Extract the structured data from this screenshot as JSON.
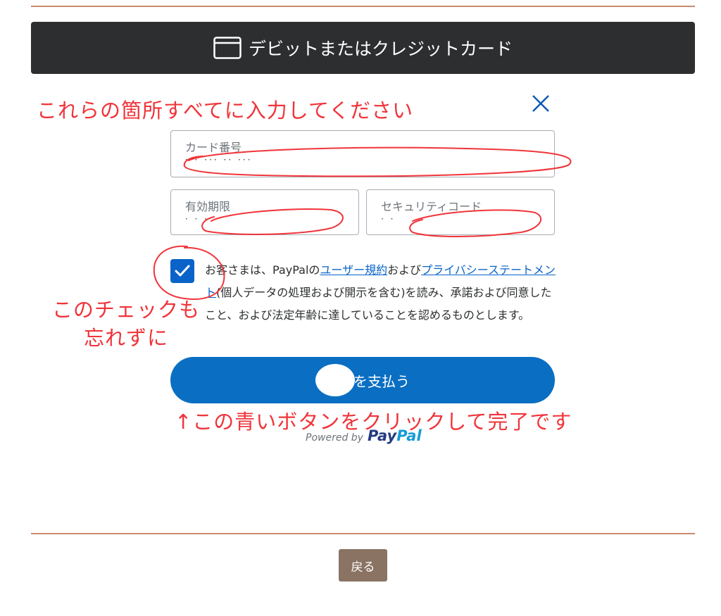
{
  "header": {
    "title": "デビットまたはクレジットカード",
    "icon": "credit-card-icon"
  },
  "annotations": {
    "top": "これらの箇所すべてに入力してください",
    "check_line1": "このチェックも",
    "check_line2": "忘れずに",
    "bottom": "↑この青いボタンをクリックして完了です",
    "color": "#f0343a"
  },
  "form": {
    "card_number_label": "カード番号",
    "card_number_value": "··· ··· ·· ···",
    "expiry_label": "有効期限",
    "expiry_value": "· · ·",
    "security_label": "セキュリティコード",
    "security_value": "· ·"
  },
  "consent": {
    "checked": true,
    "text_1": "お客さまは、PayPalの",
    "link_terms": "ユーザー規約",
    "text_2": "および",
    "link_privacy": "プライバシーステートメント",
    "text_3": "(個人データの処理および開示を含む)を読み、承諾および同意したこと、および法定年齢に達していることを認めるものとします。"
  },
  "pay_button": {
    "label": "を支払う",
    "color": "#0a6fc2"
  },
  "powered_by": {
    "prefix": "Powered by",
    "brand_1": "Pay",
    "brand_2": "Pal"
  },
  "footer": {
    "back_label": "戻る"
  }
}
